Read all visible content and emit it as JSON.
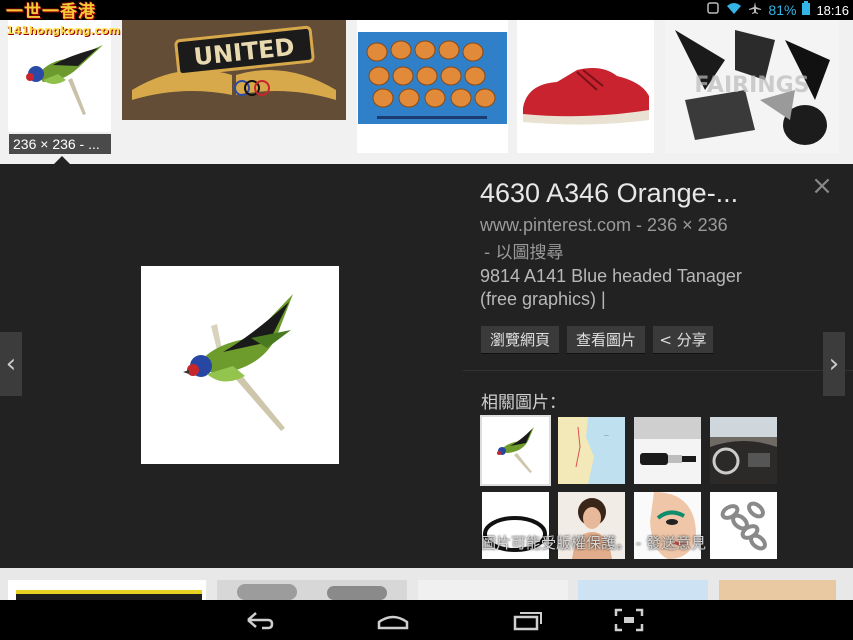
{
  "status_bar": {
    "logo_line1": "一世一香港",
    "logo_line2": "141hongkong.com",
    "battery": "81%",
    "time": "18:16"
  },
  "top_row": {
    "selected_dimensions": "236 × 236 - ..."
  },
  "detail": {
    "title": "4630 A346 Orange-...",
    "site": "www.pinterest.com - 236 × 236",
    "search_by_image": "- 以圖搜尋",
    "description_line1": "9814 A141 Blue headed Tanager",
    "description_line2": "(free graphics) |",
    "buttons": {
      "visit": "瀏覽網頁",
      "view": "查看圖片",
      "share": "< 分享"
    },
    "related_title": "相關圖片：",
    "copyright": "圖片可能受版權保護。 - 發送意見"
  },
  "nav": {
    "prev": "‹",
    "next": "›",
    "close": "×"
  },
  "colors": {
    "panel": "#222222",
    "status_accent": "#33b5e5"
  }
}
